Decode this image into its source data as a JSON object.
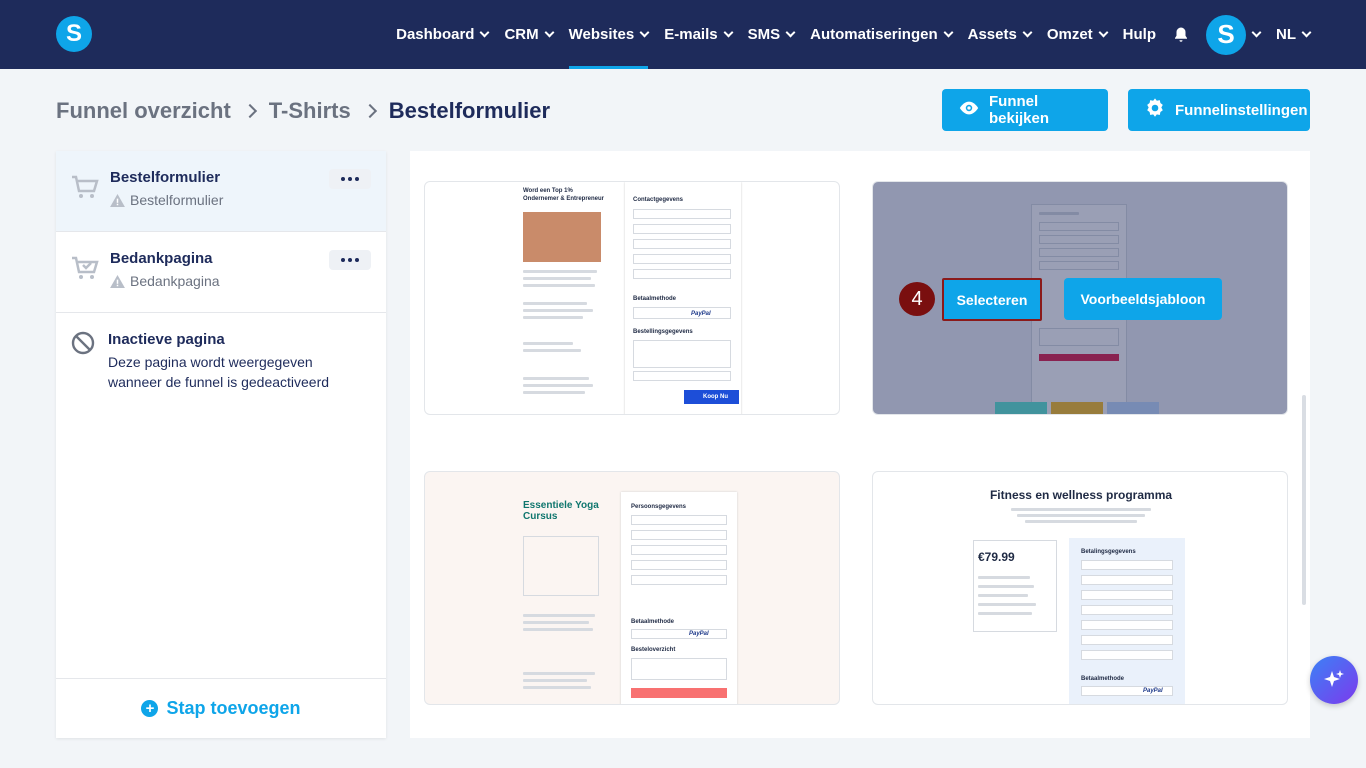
{
  "nav": {
    "logo_letter": "S",
    "items": [
      {
        "label": "Dashboard",
        "has_menu": true
      },
      {
        "label": "CRM",
        "has_menu": true
      },
      {
        "label": "Websites",
        "has_menu": true,
        "active": true
      },
      {
        "label": "E-mails",
        "has_menu": true
      },
      {
        "label": "SMS",
        "has_menu": true
      },
      {
        "label": "Automatiseringen",
        "has_menu": true
      },
      {
        "label": "Assets",
        "has_menu": true
      },
      {
        "label": "Omzet",
        "has_menu": true
      },
      {
        "label": "Hulp",
        "has_menu": false
      }
    ],
    "avatar_letter": "S",
    "language": "NL",
    "accent": "#0ea5e9",
    "bar_color": "#1e2b5b"
  },
  "breadcrumb": [
    "Funnel overzicht",
    "T-Shirts",
    "Bestelformulier"
  ],
  "header_buttons": {
    "view_funnel": "Funnel bekijken",
    "settings": "Funnelinstellingen"
  },
  "sidebar": {
    "steps": [
      {
        "title": "Bestelformulier",
        "subtitle": "Bestelformulier",
        "selected": true
      },
      {
        "title": "Bedankpagina",
        "subtitle": "Bedankpagina",
        "selected": false
      }
    ],
    "inactive": {
      "title": "Inactieve pagina",
      "description": "Deze pagina wordt weergegeven wanneer de funnel is gedeactiveerd"
    },
    "add_step": "Stap toevoegen"
  },
  "templates": {
    "card1": {
      "headline": "Word een Top 1% Ondernemer & Entrepreneur",
      "contact": "Contactgegevens",
      "payment": "Betaalmethode",
      "order": "Bestellingsgegevens",
      "buy": "Koop Nu",
      "paypal": "PayPal"
    },
    "card3": {
      "headline": "Essentiele Yoga Cursus",
      "personal": "Persoonsgegevens",
      "payment": "Betaalmethode",
      "overview": "Besteloverzicht",
      "paypal": "PayPal"
    },
    "card4": {
      "title": "Fitness en wellness programma",
      "price": "€79.99",
      "payment_details": "Betalingsgegevens",
      "payment": "Betaalmethode",
      "paypal": "PayPal"
    }
  },
  "hover_actions": {
    "select": "Selecteren",
    "example": "Voorbeeldsjabloon",
    "step_number": "4"
  }
}
